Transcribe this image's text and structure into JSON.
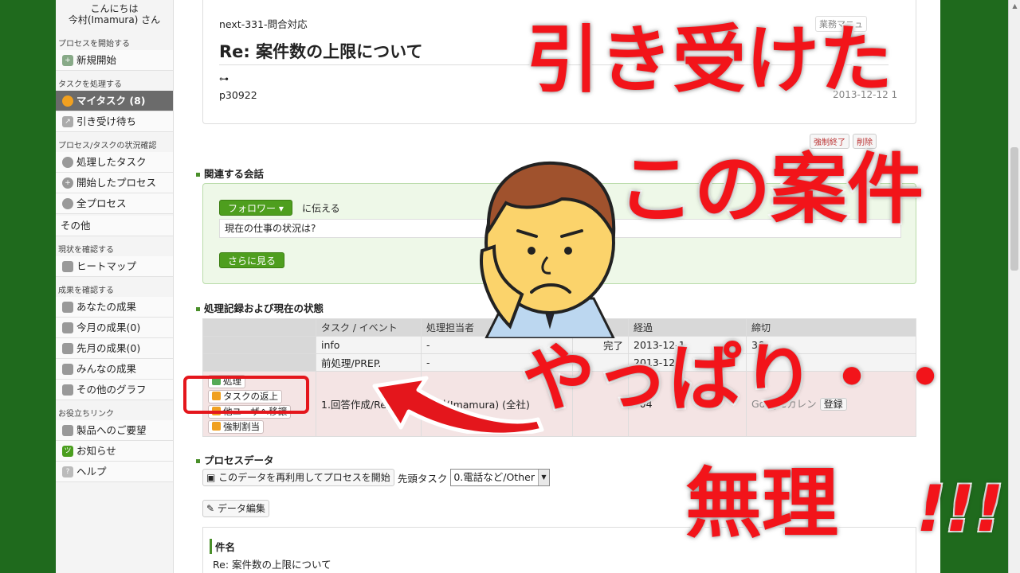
{
  "sidebar": {
    "greeting_line1": "こんにちは",
    "greeting_line2": "今村(Imamura) さん",
    "sections": [
      {
        "title": "プロセスを開始する",
        "items": [
          {
            "label": "新規開始",
            "icon": "plus-icon"
          }
        ]
      },
      {
        "title": "タスクを処理する",
        "items": [
          {
            "label": "マイタスク (8)",
            "icon": "my-task-icon",
            "active": true
          },
          {
            "label": "引き受け待ち",
            "icon": "arrow-icon"
          }
        ]
      },
      {
        "title": "プロセス/タスクの状況確認",
        "items": [
          {
            "label": "処理したタスク",
            "icon": "pie-icon"
          },
          {
            "label": "開始したプロセス",
            "icon": "plus-icon"
          },
          {
            "label": "全プロセス",
            "icon": "cluster-icon"
          }
        ]
      }
    ],
    "other_label": "その他",
    "section_status": "現状を確認する",
    "heatmap_label": "ヒートマップ",
    "section_results": "成果を確認する",
    "result_items": [
      "あなたの成果",
      "今月の成果(0)",
      "先月の成果(0)",
      "みんなの成果",
      "その他のグラフ"
    ],
    "section_links": "お役立ちリンク",
    "link_items": [
      "製品へのご要望",
      "お知らせ",
      "ヘルプ"
    ]
  },
  "header": {
    "ticket_id": "next-331-問合対応",
    "title": "Re: 案件数の上限について",
    "code": "p30922",
    "manual_label": "業務マニュ",
    "date": "2013-12-12 1",
    "force_end_label": "強制終了",
    "delete_label": "削除"
  },
  "conversation": {
    "heading": "関連する会話",
    "follower_button": "フォロワー ▾",
    "tell_label": "に伝える",
    "input_value": "現在の仕事の状況は?",
    "more_button": "さらに見る"
  },
  "process_log": {
    "heading": "処理記録および現在の状態",
    "columns": [
      "",
      "タスク / イベント",
      "処理担当者",
      "",
      "経過",
      "締切"
    ],
    "rows": [
      {
        "task": "info",
        "person": "-",
        "status": "完了",
        "elapsed": "2013-12-1",
        "deadline": "36"
      },
      {
        "task": "前処理/PREP.",
        "person": "-",
        "status": "",
        "elapsed": "2013-12-1",
        "deadline": ""
      }
    ],
    "current": {
      "task": "1.回答作成/Reply",
      "person": "今村(Imamura) (全社)",
      "elapsed": "»04",
      "action_buttons": [
        "処理",
        "タスクの返上",
        "他ユーザへ移譲",
        "強制割当"
      ],
      "calendar_label": "Googleカレン",
      "register_label": "登録"
    }
  },
  "process_data": {
    "heading": "プロセスデータ",
    "reuse_button": "このデータを再利用してプロセスを開始",
    "first_task_label": "先頭タスク",
    "first_task_value": "0.電話など/Other",
    "edit_button": "データ編集",
    "subject_label": "件名",
    "subject_value": "Re: 案件数の上限について"
  },
  "overlay": {
    "line1": "引き受けた",
    "line2": "この案件",
    "line3": "やっぱり・・",
    "line4": "無理",
    "line5": "!!!"
  }
}
